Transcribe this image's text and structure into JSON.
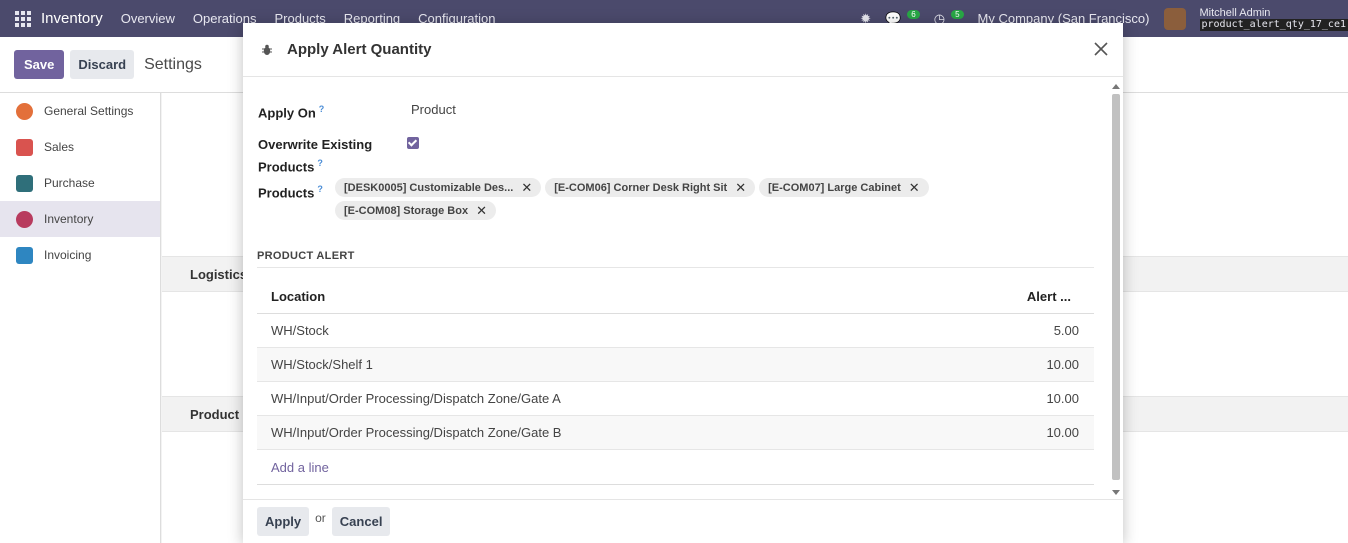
{
  "navbar": {
    "app_name": "Inventory",
    "menu": [
      "Overview",
      "Operations",
      "Products",
      "Reporting",
      "Configuration"
    ],
    "messages_badge": "6",
    "activities_badge": "5",
    "company": "My Company (San Francisco)",
    "user_name": "Mitchell Admin",
    "database": "product_alert_qty_17_ce1"
  },
  "control_panel": {
    "save_label": "Save",
    "discard_label": "Discard",
    "title": "Settings"
  },
  "sidebar": {
    "items": [
      {
        "label": "General Settings",
        "color": "#e3703a"
      },
      {
        "label": "Sales",
        "color": "#d9534f"
      },
      {
        "label": "Purchase",
        "color": "#2f6f7a"
      },
      {
        "label": "Inventory",
        "color": "#b83b5e"
      },
      {
        "label": "Invoicing",
        "color": "#2e86c1"
      }
    ],
    "active_index": 3
  },
  "settings_sections": [
    "Logistics",
    "Product"
  ],
  "dialog": {
    "title": "Apply Alert Quantity",
    "apply_on_label": "Apply On",
    "apply_on_value": "Product",
    "overwrite_label_line1": "Overwrite Existing",
    "overwrite_label_line2": "Products",
    "overwrite_checked": true,
    "products_label": "Products",
    "help_mark": "?",
    "products": [
      "[DESK0005] Customizable Des...",
      "[E-COM06] Corner Desk Right Sit",
      "[E-COM07] Large Cabinet",
      "[E-COM08] Storage Box"
    ],
    "section_title": "PRODUCT ALERT",
    "table": {
      "headers": [
        "Location",
        "Alert ..."
      ],
      "rows": [
        {
          "location": "WH/Stock",
          "alert": "5.00"
        },
        {
          "location": "WH/Stock/Shelf 1",
          "alert": "10.00"
        },
        {
          "location": "WH/Input/Order Processing/Dispatch Zone/Gate A",
          "alert": "10.00"
        },
        {
          "location": "WH/Input/Order Processing/Dispatch Zone/Gate B",
          "alert": "10.00"
        }
      ],
      "add_line": "Add a line"
    },
    "apply_label": "Apply",
    "or_label": "or",
    "cancel_label": "Cancel"
  },
  "colors": {
    "navbar": "#4b4a6c",
    "primary": "#71639e"
  }
}
